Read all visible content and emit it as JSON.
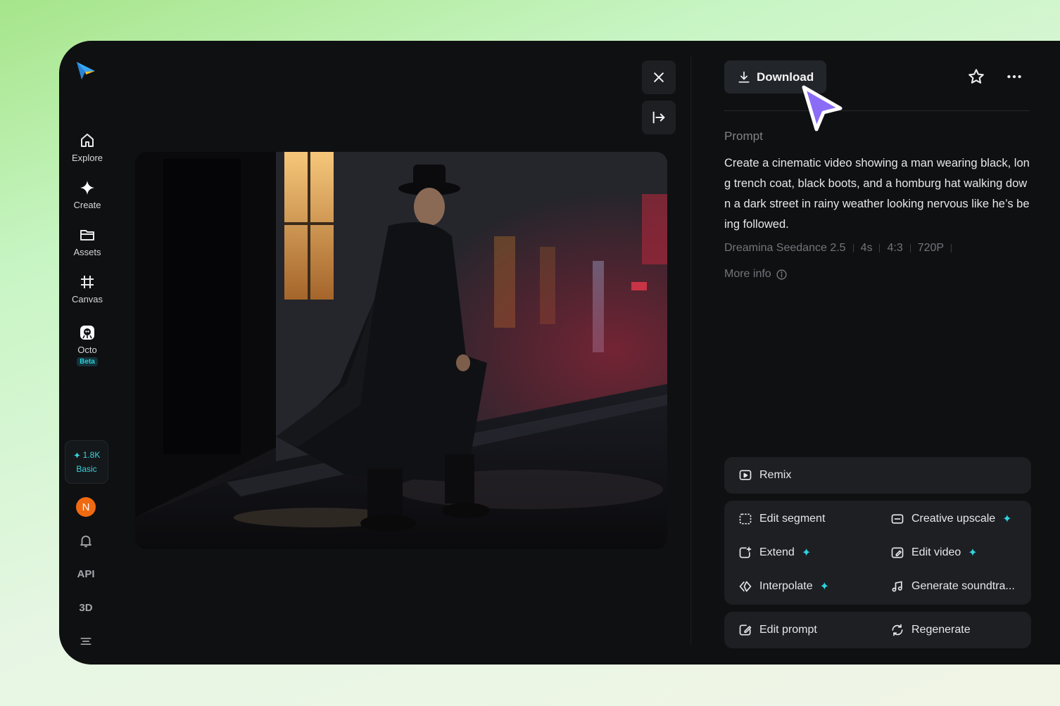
{
  "sidebar": {
    "items": [
      {
        "label": "Explore",
        "icon": "home-icon"
      },
      {
        "label": "Create",
        "icon": "sparkle-icon"
      },
      {
        "label": "Assets",
        "icon": "folder-icon"
      },
      {
        "label": "Canvas",
        "icon": "canvas-grid-icon"
      },
      {
        "label": "Octo",
        "icon": "octo-icon",
        "badge": "Beta"
      }
    ],
    "credits": {
      "amount": "1.8K",
      "plan": "Basic"
    },
    "avatar_initial": "N",
    "api_label": "API",
    "three_d_label": "3D"
  },
  "viewer": {
    "close_icon": "close-icon",
    "collapse_icon": "collapse-right-icon"
  },
  "panel": {
    "download_label": "Download",
    "prompt_heading": "Prompt",
    "prompt_text": "Create a cinematic video showing a man wearing black, long trench coat, black boots, and a homburg hat walking down a dark street in rainy weather looking nervous like he’s being followed.",
    "meta": [
      "Dreamina Seedance 2.5",
      "4s",
      "4:3",
      "720P"
    ],
    "more_info_label": "More info",
    "remix_label": "Remix",
    "actions": {
      "edit_segment": "Edit segment",
      "creative_upscale": "Creative upscale",
      "extend": "Extend",
      "edit_video": "Edit video",
      "interpolate": "Interpolate",
      "generate_soundtrack": "Generate soundtra...",
      "edit_prompt": "Edit prompt",
      "regenerate": "Regenerate"
    }
  },
  "colors": {
    "accent": "#2fd3e0",
    "cursor": "#8b6cf6",
    "avatar": "#f06a12"
  }
}
